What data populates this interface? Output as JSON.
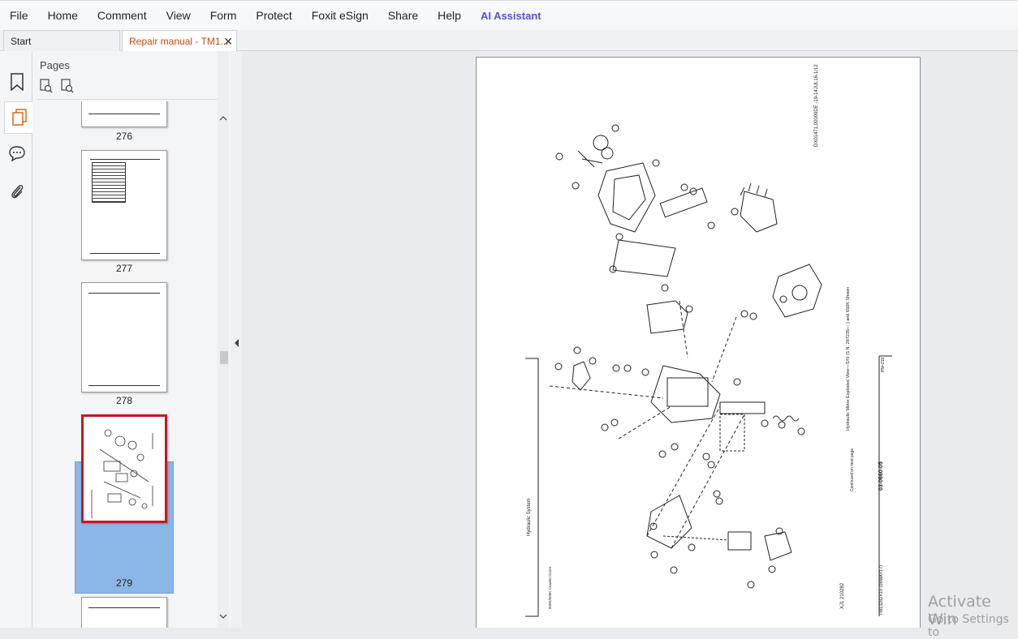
{
  "menu": [
    "File",
    "Home",
    "Comment",
    "View",
    "Form",
    "Protect",
    "Foxit eSign",
    "Share",
    "Help"
  ],
  "ai_assistant": "AI Assistant",
  "tabs": {
    "start": "Start",
    "active": "Repair manual - TM1...",
    "close": "✕"
  },
  "panel": {
    "title": "Pages"
  },
  "thumbnails": [
    {
      "label": "276"
    },
    {
      "label": "277"
    },
    {
      "label": "278"
    },
    {
      "label": "279"
    },
    {
      "label": ""
    }
  ],
  "selected_page": "279",
  "page_text": {
    "top_right_code": "DX01471,00009DE -19-14JUL16-1/12",
    "section_title": "Hydraulic System",
    "caption": "Hydraulic Motor Exploded View—S/N (S.N. 297235— ) and 650K Shown",
    "continued": "Continued on next page",
    "page_code": "03-0660-05",
    "page_code2": "PN=219",
    "footer_left": "XJ1 210282",
    "footer_right": "TM13282X19 (08MAY17)",
    "footer_center": "850K/650K Crawler Dozer"
  },
  "watermark": {
    "line1": "Activate Win",
    "line2": "Go to Settings to"
  },
  "colors": {
    "accent": "#c24a14",
    "ai": "#5b4fd6",
    "selection": "#8ab7e6",
    "selected_border": "#c8161d"
  }
}
